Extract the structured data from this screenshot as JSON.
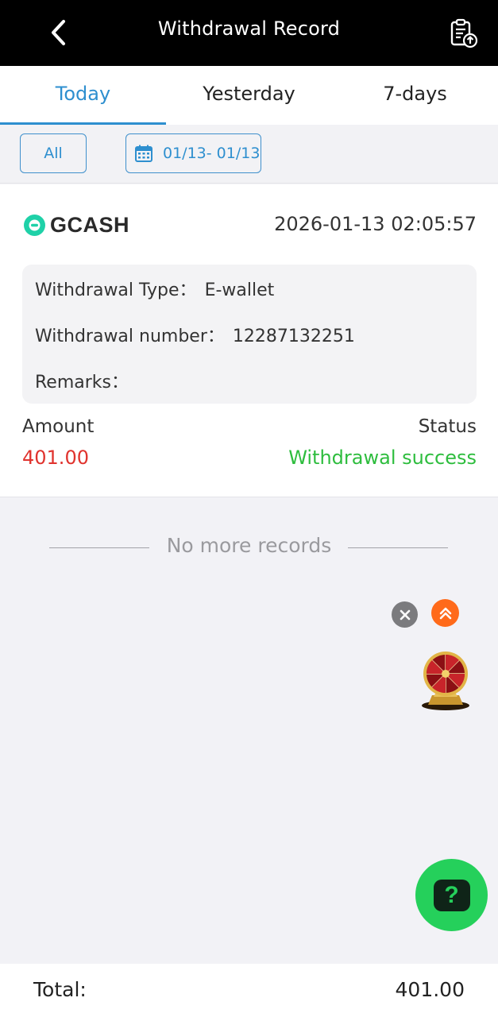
{
  "header": {
    "title": "Withdrawal Record",
    "back_icon": "chevron-left-icon",
    "action_icon": "clipboard-upload-icon"
  },
  "tabs": [
    {
      "label": "Today",
      "active": true
    },
    {
      "label": "Yesterday",
      "active": false
    },
    {
      "label": "7-days",
      "active": false
    }
  ],
  "filters": {
    "all_label": "All",
    "date_range": "01/13- 01/13",
    "date_icon": "calendar-icon"
  },
  "record": {
    "method_name": "GCASH",
    "datetime": "2026-01-13 02:05:57",
    "type_label": "Withdrawal Type：",
    "type_value": "E-wallet",
    "number_label": "Withdrawal number：",
    "number_value": "12287132251",
    "remarks_label": "Remarks：",
    "remarks_value": "",
    "amount_label": "Amount",
    "amount_value": "401.00",
    "status_label": "Status",
    "status_value": "Withdrawal success"
  },
  "list_end_text": "No more records",
  "footer": {
    "total_label": "Total:",
    "total_value": "401.00"
  },
  "colors": {
    "accent": "#2e8fcf",
    "amount": "#e0332e",
    "success": "#2ebd3e",
    "help_button": "#25d05b",
    "scroll_top_button": "#ff6a1a"
  }
}
